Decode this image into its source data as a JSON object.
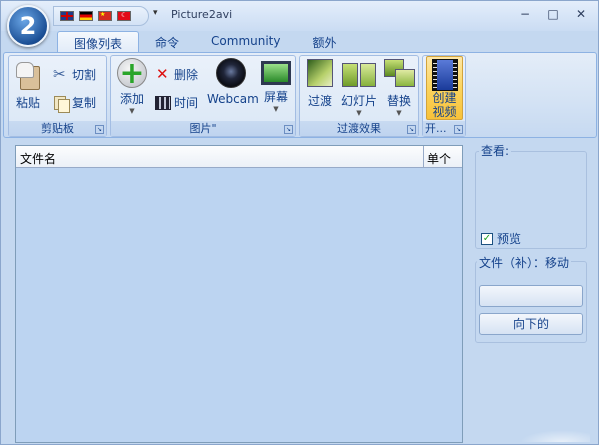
{
  "window": {
    "title": "Picture2avi",
    "orb_glyph": "2",
    "controls": {
      "minimize": "−",
      "maximize": "□",
      "close": "✕"
    }
  },
  "quick_access": {
    "flags": [
      "flag-uk-icon",
      "flag-de-icon",
      "flag-cn-icon",
      "flag-tr-icon"
    ],
    "dropdown_glyph": "▾"
  },
  "tabs": [
    {
      "label": "图像列表",
      "active": true
    },
    {
      "label": "命令",
      "active": false
    },
    {
      "label": "Community",
      "active": false
    },
    {
      "label": "额外",
      "active": false
    }
  ],
  "ribbon": {
    "clipboard": {
      "label": "剪贴板",
      "paste": "粘贴",
      "cut": "切割",
      "copy": "复制"
    },
    "pictures": {
      "label": "图片\"",
      "add": "添加",
      "delete": "删除",
      "time": "时间",
      "webcam": "Webcam",
      "screen": "屏幕"
    },
    "transitions": {
      "label": "过渡效果",
      "transition": "过渡",
      "slideshow": "幻灯片",
      "replace": "替换"
    },
    "create": {
      "label": "开...",
      "create_line1": "创建",
      "create_line2": "视频"
    }
  },
  "list": {
    "columns": [
      "文件名",
      "单个"
    ]
  },
  "side": {
    "view_label": "查看:",
    "preview_label": "预览",
    "preview_checked": true,
    "file_label": "文件（补）：移动",
    "button_top": "",
    "button_down": "向下的"
  },
  "colors": {
    "accent": "#15428b",
    "ribbon_bg": "#dae7f6",
    "list_bg": "#bcd4f1",
    "create_btn": "#fbd45e"
  }
}
